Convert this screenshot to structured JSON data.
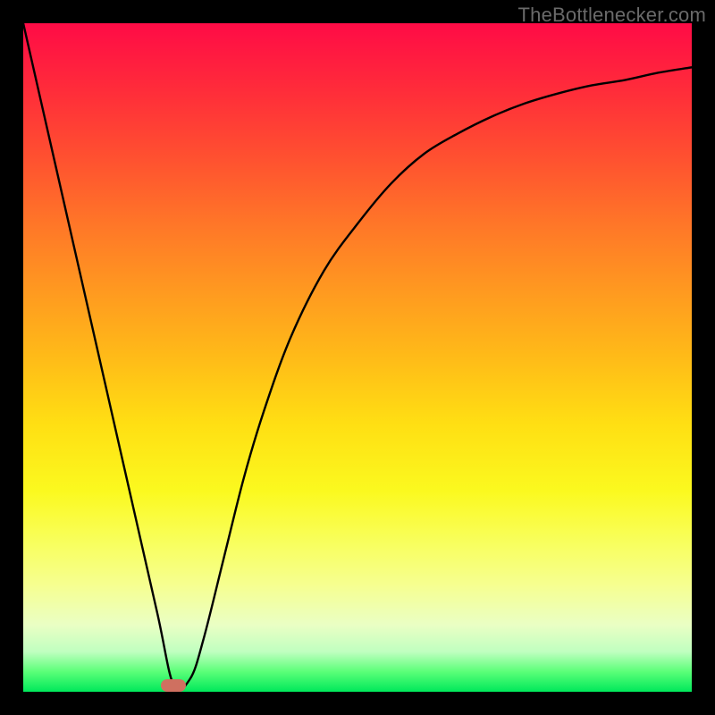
{
  "attribution": "TheBottlenecker.com",
  "colors": {
    "frame_border": "#000000",
    "curve": "#000000",
    "marker": "#cf7060",
    "gradient_top": "#ff0b46",
    "gradient_bottom": "#00e85b"
  },
  "chart_data": {
    "type": "line",
    "title": "",
    "xlabel": "",
    "ylabel": "",
    "xlim": [
      0,
      100
    ],
    "ylim": [
      0,
      100
    ],
    "series": [
      {
        "name": "bottleneck-curve",
        "x": [
          0,
          5,
          10,
          15,
          20,
          22.5,
          25,
          27,
          30,
          33,
          36,
          40,
          45,
          50,
          55,
          60,
          65,
          70,
          75,
          80,
          85,
          90,
          95,
          100
        ],
        "values": [
          100,
          78,
          56,
          34,
          12,
          1,
          2,
          8,
          20,
          32,
          42,
          53,
          63,
          70,
          76,
          80.5,
          83.5,
          86,
          88,
          89.5,
          90.7,
          91.5,
          92.6,
          93.4
        ]
      }
    ],
    "markers": [
      {
        "name": "minimum-point",
        "x": 22.5,
        "y": 1
      }
    ],
    "notes": "No axes, ticks, or legend are visible in the source image; values are estimated from pixel positions relative to the plot area."
  }
}
